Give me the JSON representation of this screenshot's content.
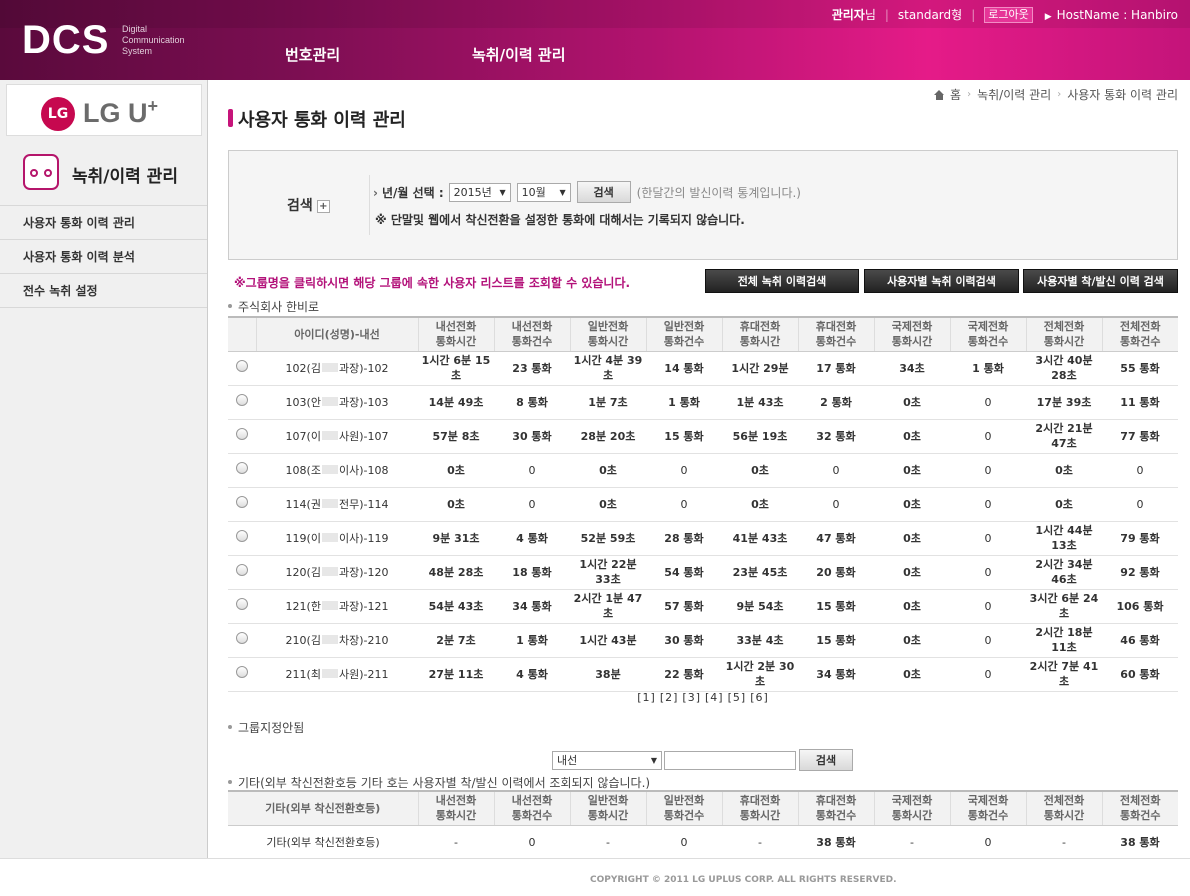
{
  "header": {
    "logo": "DCS",
    "logo_sub": "Digital Communication System",
    "admin_bold": "관리자",
    "admin_suffix": "님",
    "plan": "standard형",
    "logout": "로그아웃",
    "host": "HostName : Hanbiro",
    "nav": [
      "번호관리",
      "녹취/이력 관리"
    ]
  },
  "sidebar": {
    "brand": "LG U",
    "brand_sup": "+",
    "brand_circle": "LG",
    "title": "녹취/이력 관리",
    "items": [
      "사용자 통화 이력 관리",
      "사용자 통화 이력 분석",
      "전수 녹취 설정"
    ]
  },
  "breadcrumb": [
    "홈",
    "녹취/이력 관리",
    "사용자 통화 이력 관리"
  ],
  "page_title": "사용자 통화 이력 관리",
  "search": {
    "label": "검색",
    "plus": "+",
    "date_label": "년/월 선택 :",
    "year": "2015년",
    "month": "10월",
    "button": "검색",
    "hint": "(한달간의 발신이력 통계입니다.)",
    "note": "※ 단말및 웹에서 착신전환을 설정한 통화에 대해서는 기록되지 않습니다."
  },
  "notice": "※그룹명을 클릭하시면 해당 그룹에 속한 사용자 리스트를 조회할 수 있습니다.",
  "buttons": [
    "전체 녹취 이력검색",
    "사용자별 녹취 이력검색",
    "사용자별 착/발신 이력 검색"
  ],
  "group1": {
    "label": "주식회사 한비로",
    "headers": [
      "아이디(성명)-내선",
      "내선전화\n통화시간",
      "내선전화\n통화건수",
      "일반전화\n통화시간",
      "일반전화\n통화건수",
      "휴대전화\n통화시간",
      "휴대전화\n통화건수",
      "국제전화\n통화시간",
      "국제전화\n통화건수",
      "전체전화\n통화시간",
      "전체전화\n통화건수"
    ],
    "rows": [
      {
        "id_pre": "102(김",
        "id_post": "과장)-102",
        "c": [
          "1시간 6분 15초",
          "23 통화",
          "1시간 4분 39초",
          "14 통화",
          "1시간 29분",
          "17 통화",
          "34초",
          "1 통화",
          "3시간 40분 28초",
          "55 통화"
        ]
      },
      {
        "id_pre": "103(안",
        "id_post": "과장)-103",
        "c": [
          "14분 49초",
          "8 통화",
          "1분 7초",
          "1 통화",
          "1분 43초",
          "2 통화",
          "0초",
          "0",
          "17분 39초",
          "11 통화"
        ]
      },
      {
        "id_pre": "107(이",
        "id_post": "사원)-107",
        "c": [
          "57분 8초",
          "30 통화",
          "28분 20초",
          "15 통화",
          "56분 19초",
          "32 통화",
          "0초",
          "0",
          "2시간 21분 47초",
          "77 통화"
        ]
      },
      {
        "id_pre": "108(조",
        "id_post": "이사)-108",
        "c": [
          "0초",
          "0",
          "0초",
          "0",
          "0초",
          "0",
          "0초",
          "0",
          "0초",
          "0"
        ]
      },
      {
        "id_pre": "114(권",
        "id_post": "전무)-114",
        "c": [
          "0초",
          "0",
          "0초",
          "0",
          "0초",
          "0",
          "0초",
          "0",
          "0초",
          "0"
        ]
      },
      {
        "id_pre": "119(이",
        "id_post": "이사)-119",
        "c": [
          "9분 31초",
          "4 통화",
          "52분 59초",
          "28 통화",
          "41분 43초",
          "47 통화",
          "0초",
          "0",
          "1시간 44분 13초",
          "79 통화"
        ]
      },
      {
        "id_pre": "120(김",
        "id_post": "과장)-120",
        "c": [
          "48분 28초",
          "18 통화",
          "1시간 22분 33초",
          "54 통화",
          "23분 45초",
          "20 통화",
          "0초",
          "0",
          "2시간 34분 46초",
          "92 통화"
        ]
      },
      {
        "id_pre": "121(한",
        "id_post": "과장)-121",
        "c": [
          "54분 43초",
          "34 통화",
          "2시간 1분 47초",
          "57 통화",
          "9분 54초",
          "15 통화",
          "0초",
          "0",
          "3시간 6분 24초",
          "106 통화"
        ]
      },
      {
        "id_pre": "210(김",
        "id_post": "차장)-210",
        "c": [
          "2분 7초",
          "1 통화",
          "1시간 43분",
          "30 통화",
          "33분 4초",
          "15 통화",
          "0초",
          "0",
          "2시간 18분 11초",
          "46 통화"
        ]
      },
      {
        "id_pre": "211(최",
        "id_post": "사원)-211",
        "c": [
          "27분 11초",
          "4 통화",
          "38분",
          "22 통화",
          "1시간 2분 30초",
          "34 통화",
          "0초",
          "0",
          "2시간 7분 41초",
          "60 통화"
        ]
      }
    ]
  },
  "pager": [
    "[1]",
    "[2]",
    "[3]",
    "[4]",
    "[5]",
    "[6]"
  ],
  "group2": {
    "label": "그룹지정안됨"
  },
  "filter": {
    "select": "내선",
    "button": "검색"
  },
  "group3": {
    "label": "기타(외부 착신전환호등 기타 호는 사용자별 착/발신 이력에서 조회되지 않습니다.)",
    "headers": [
      "기타(외부 착신전환호등)",
      "내선전화\n통화시간",
      "내선전화\n통화건수",
      "일반전화\n통화시간",
      "일반전화\n통화건수",
      "휴대전화\n통화시간",
      "휴대전화\n통화건수",
      "국제전화\n통화시간",
      "국제전화\n통화건수",
      "전체전화\n통화시간",
      "전체전화\n통화건수"
    ],
    "row": [
      "기타(외부 착신전환호등)",
      "-",
      "0",
      "-",
      "0",
      "-",
      "38 통화",
      "-",
      "0",
      "-",
      "38 통화"
    ]
  },
  "footer": "COPYRIGHT © 2011 LG UPLUS CORP. ALL RIGHTS RESERVED.",
  "colors": {
    "accent": "#c6147a",
    "header_dark": "#5a0a3c",
    "header_bright": "#e51b88"
  }
}
